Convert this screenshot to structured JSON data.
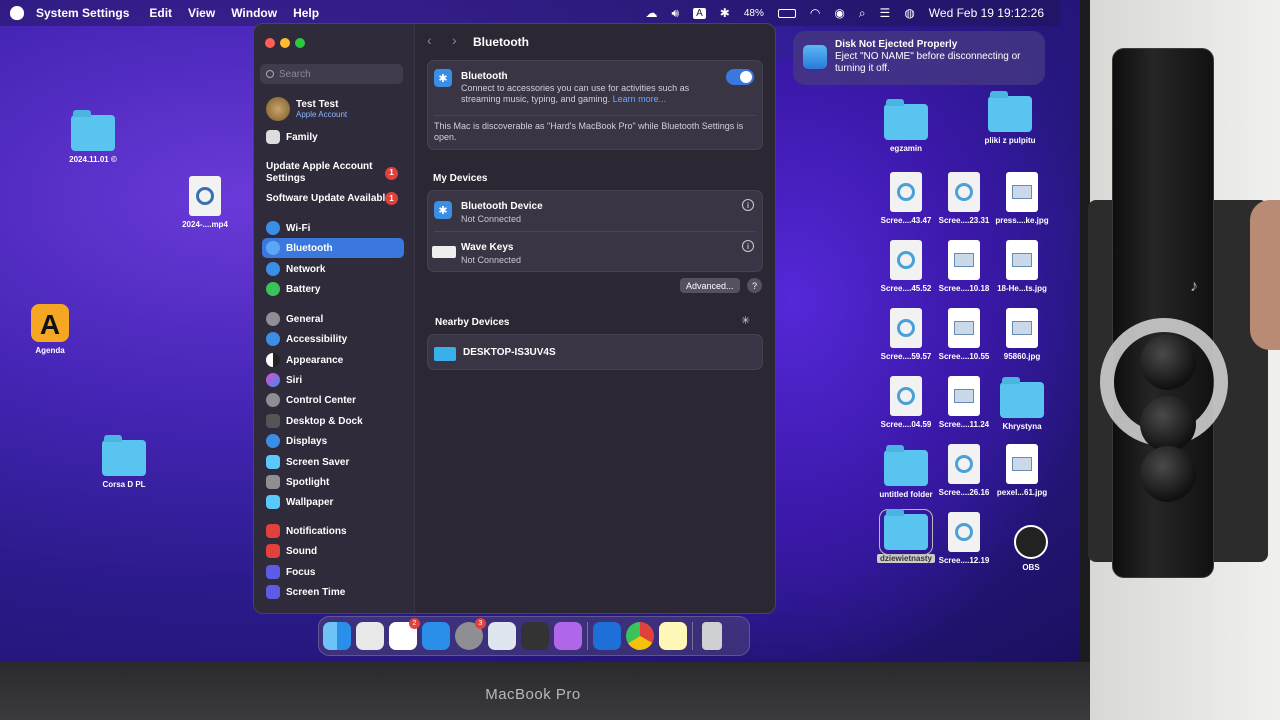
{
  "menubar": {
    "app": "System Settings",
    "items": [
      "Edit",
      "View",
      "Window",
      "Help"
    ],
    "keyboard": "A",
    "battery": "48%",
    "datetime": "Wed Feb 19  19:12:26"
  },
  "notification": {
    "title": "Disk Not Ejected Properly",
    "body": "Eject \"NO NAME\" before disconnecting or turning it off."
  },
  "desktop": {
    "left": [
      {
        "label": "2024.11.01 ©",
        "kind": "folder"
      },
      {
        "label": "2024-....mp4",
        "kind": "mp4"
      },
      {
        "label": "Agenda",
        "kind": "app"
      },
      {
        "label": "Corsa D PL",
        "kind": "folder"
      }
    ],
    "right": [
      {
        "label": "egzamin",
        "kind": "folder"
      },
      {
        "label": "pliki z pulpitu",
        "kind": "folder"
      },
      {
        "label": "Scree....43.47",
        "kind": "screenshot"
      },
      {
        "label": "Scree....23.31",
        "kind": "screenshot"
      },
      {
        "label": "press....ke.jpg",
        "kind": "jpg"
      },
      {
        "label": "Scree....45.52",
        "kind": "screenshot"
      },
      {
        "label": "Scree....10.18",
        "kind": "jpg"
      },
      {
        "label": "18-He...ts.jpg",
        "kind": "jpg"
      },
      {
        "label": "Scree....59.57",
        "kind": "screenshot"
      },
      {
        "label": "Scree....10.55",
        "kind": "jpg"
      },
      {
        "label": "95860.jpg",
        "kind": "jpg"
      },
      {
        "label": "Scree....04.59",
        "kind": "screenshot"
      },
      {
        "label": "Scree....11.24",
        "kind": "jpg"
      },
      {
        "label": "Khrystyna",
        "kind": "folder"
      },
      {
        "label": "untitled folder",
        "kind": "folder"
      },
      {
        "label": "Scree....26.16",
        "kind": "screenshot"
      },
      {
        "label": "pexel...61.jpg",
        "kind": "jpg"
      },
      {
        "label": "dziewietnasty",
        "kind": "folder"
      },
      {
        "label": "Scree....12.19",
        "kind": "screenshot"
      },
      {
        "label": "OBS",
        "kind": "obs"
      }
    ]
  },
  "sidebar": {
    "search_placeholder": "Search",
    "account_name": "Test Test",
    "account_sub": "Apple Account",
    "family": "Family",
    "update_account": "Update Apple Account Settings",
    "update_account_badge": "1",
    "software_update": "Software Update Available",
    "software_update_badge": "1",
    "items": [
      "Wi-Fi",
      "Bluetooth",
      "Network",
      "Battery",
      "General",
      "Accessibility",
      "Appearance",
      "Siri",
      "Control Center",
      "Desktop & Dock",
      "Displays",
      "Screen Saver",
      "Spotlight",
      "Wallpaper",
      "Notifications",
      "Sound",
      "Focus",
      "Screen Time"
    ]
  },
  "content": {
    "title": "Bluetooth",
    "bt_label": "Bluetooth",
    "bt_desc": "Connect to accessories you can use for activities such as streaming music, typing, and gaming.",
    "learn_more": "Learn more...",
    "discoverable": "This Mac is discoverable as \"Hard's MacBook Pro\" while Bluetooth Settings is open.",
    "my_devices": "My Devices",
    "devices": [
      {
        "name": "Bluetooth Device",
        "status": "Not Connected"
      },
      {
        "name": "Wave Keys",
        "status": "Not Connected"
      }
    ],
    "advanced": "Advanced...",
    "help": "?",
    "nearby": "Nearby Devices",
    "nearby_devices": [
      "DESKTOP-IS3UV4S"
    ]
  },
  "dock": {
    "badges": {
      "reminders": "2",
      "settings": "3"
    }
  },
  "hardware": {
    "model": "MacBook Pro"
  }
}
